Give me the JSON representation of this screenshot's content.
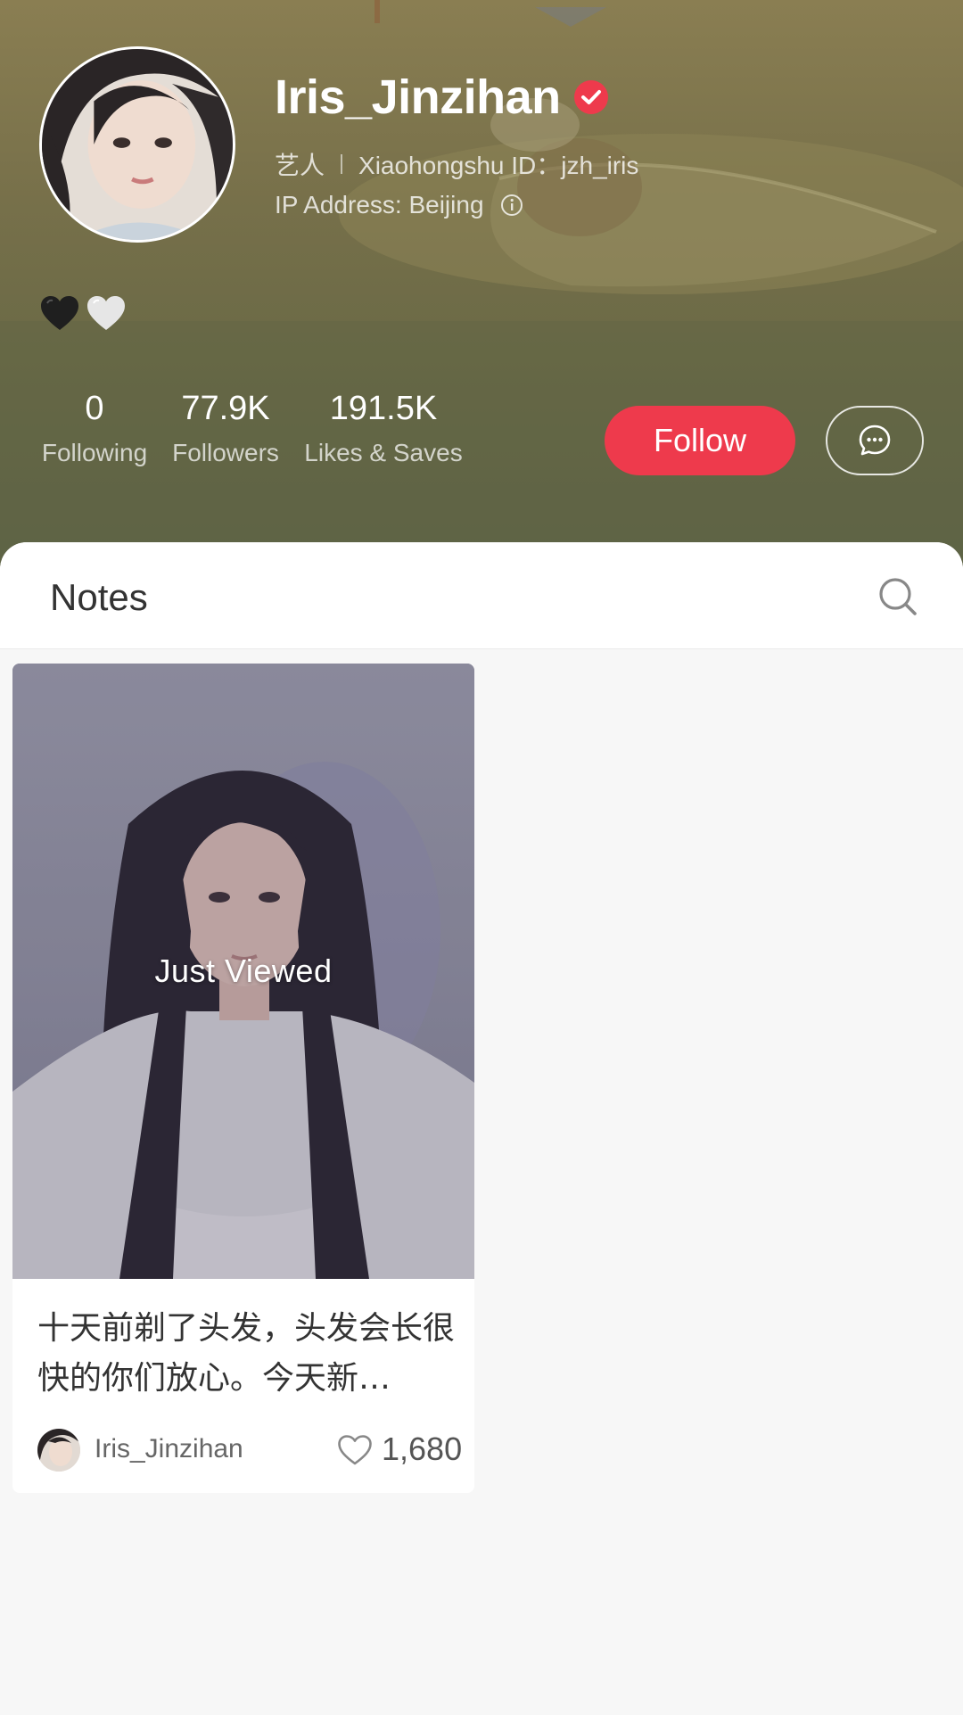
{
  "profile": {
    "name": "Iris_Jinzihan",
    "tag": "艺人",
    "id_text": "Xiaohongshu ID：jzh_iris",
    "ip_text": "IP Address: Beijing",
    "bio_icons": [
      "black-heart-icon",
      "white-heart-icon"
    ]
  },
  "stats": [
    {
      "value": "0",
      "label": "Following"
    },
    {
      "value": "77.9K",
      "label": "Followers"
    },
    {
      "value": "191.5K",
      "label": "Likes & Saves"
    }
  ],
  "actions": {
    "follow_label": "Follow",
    "message_icon": "chat-bubble-icon"
  },
  "notes": {
    "tab_label": "Notes",
    "search_icon": "search-icon",
    "items": [
      {
        "overlay": "Just Viewed",
        "title": "十天前剃了头发，头发会长很快的你们放心。今天新…",
        "author": "Iris_Jinzihan",
        "likes": "1,680"
      }
    ]
  },
  "colors": {
    "accent": "#ee3a4c",
    "banner": "#6e6b47",
    "verified": "#ee3a4c"
  }
}
